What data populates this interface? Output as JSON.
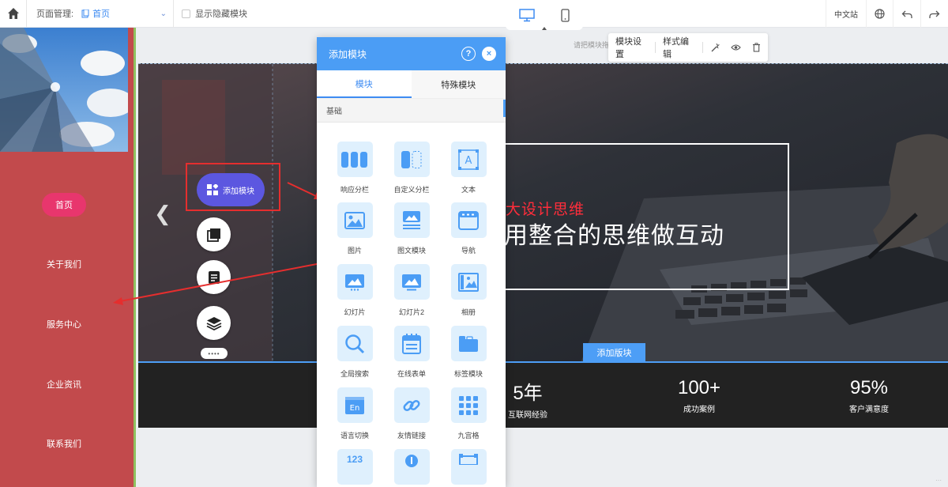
{
  "toolbar": {
    "page_manage_label": "页面管理:",
    "current_page": "首页",
    "show_hidden_label": "显示隐藏模块",
    "lang_label": "中文站"
  },
  "sidebar": {
    "nav": [
      {
        "label": "首页",
        "active": true
      },
      {
        "label": "关于我们",
        "active": false
      },
      {
        "label": "服务中心",
        "active": false
      },
      {
        "label": "企业资讯",
        "active": false
      },
      {
        "label": "联系我们",
        "active": false
      }
    ]
  },
  "canvas": {
    "hint": "请把模块拖",
    "banner_subtitle": "大设计思维",
    "banner_title": "用整合的思维做互动",
    "add_block_label": "添加版块"
  },
  "module_bar": {
    "settings": "模块设置",
    "style_edit": "样式编辑"
  },
  "floating": {
    "add_module": "添加模块"
  },
  "stats": [
    {
      "num": "5年",
      "label": "互联网经验"
    },
    {
      "num": "100+",
      "label": "成功案例"
    },
    {
      "num": "95%",
      "label": "客户满意度"
    }
  ],
  "panel": {
    "title": "添加模块",
    "help": "?",
    "close": "×",
    "tabs": [
      "模块",
      "特殊模块"
    ],
    "section": "基础",
    "modules": [
      {
        "label": "响应分栏",
        "icon": "columns-icon"
      },
      {
        "label": "自定义分栏",
        "icon": "custom-columns-icon"
      },
      {
        "label": "文本",
        "icon": "text-icon"
      },
      {
        "label": "图片",
        "icon": "image-icon"
      },
      {
        "label": "图文模块",
        "icon": "image-text-icon"
      },
      {
        "label": "导航",
        "icon": "navigation-icon"
      },
      {
        "label": "幻灯片",
        "icon": "slideshow-icon"
      },
      {
        "label": "幻灯片2",
        "icon": "slideshow2-icon"
      },
      {
        "label": "相册",
        "icon": "album-icon"
      },
      {
        "label": "全局搜索",
        "icon": "search-icon"
      },
      {
        "label": "在线表单",
        "icon": "form-icon"
      },
      {
        "label": "标签模块",
        "icon": "tabs-icon"
      },
      {
        "label": "语言切换",
        "icon": "language-icon"
      },
      {
        "label": "友情链接",
        "icon": "link-icon"
      },
      {
        "label": "九宫格",
        "icon": "grid-icon"
      }
    ],
    "partial_icon_text": "123"
  },
  "colors": {
    "accent": "#4b9df5",
    "sidebar": "#c24a4c",
    "nav_active": "#e8366d",
    "fab": "#5c57e0",
    "highlight_red": "#e52e2e"
  }
}
